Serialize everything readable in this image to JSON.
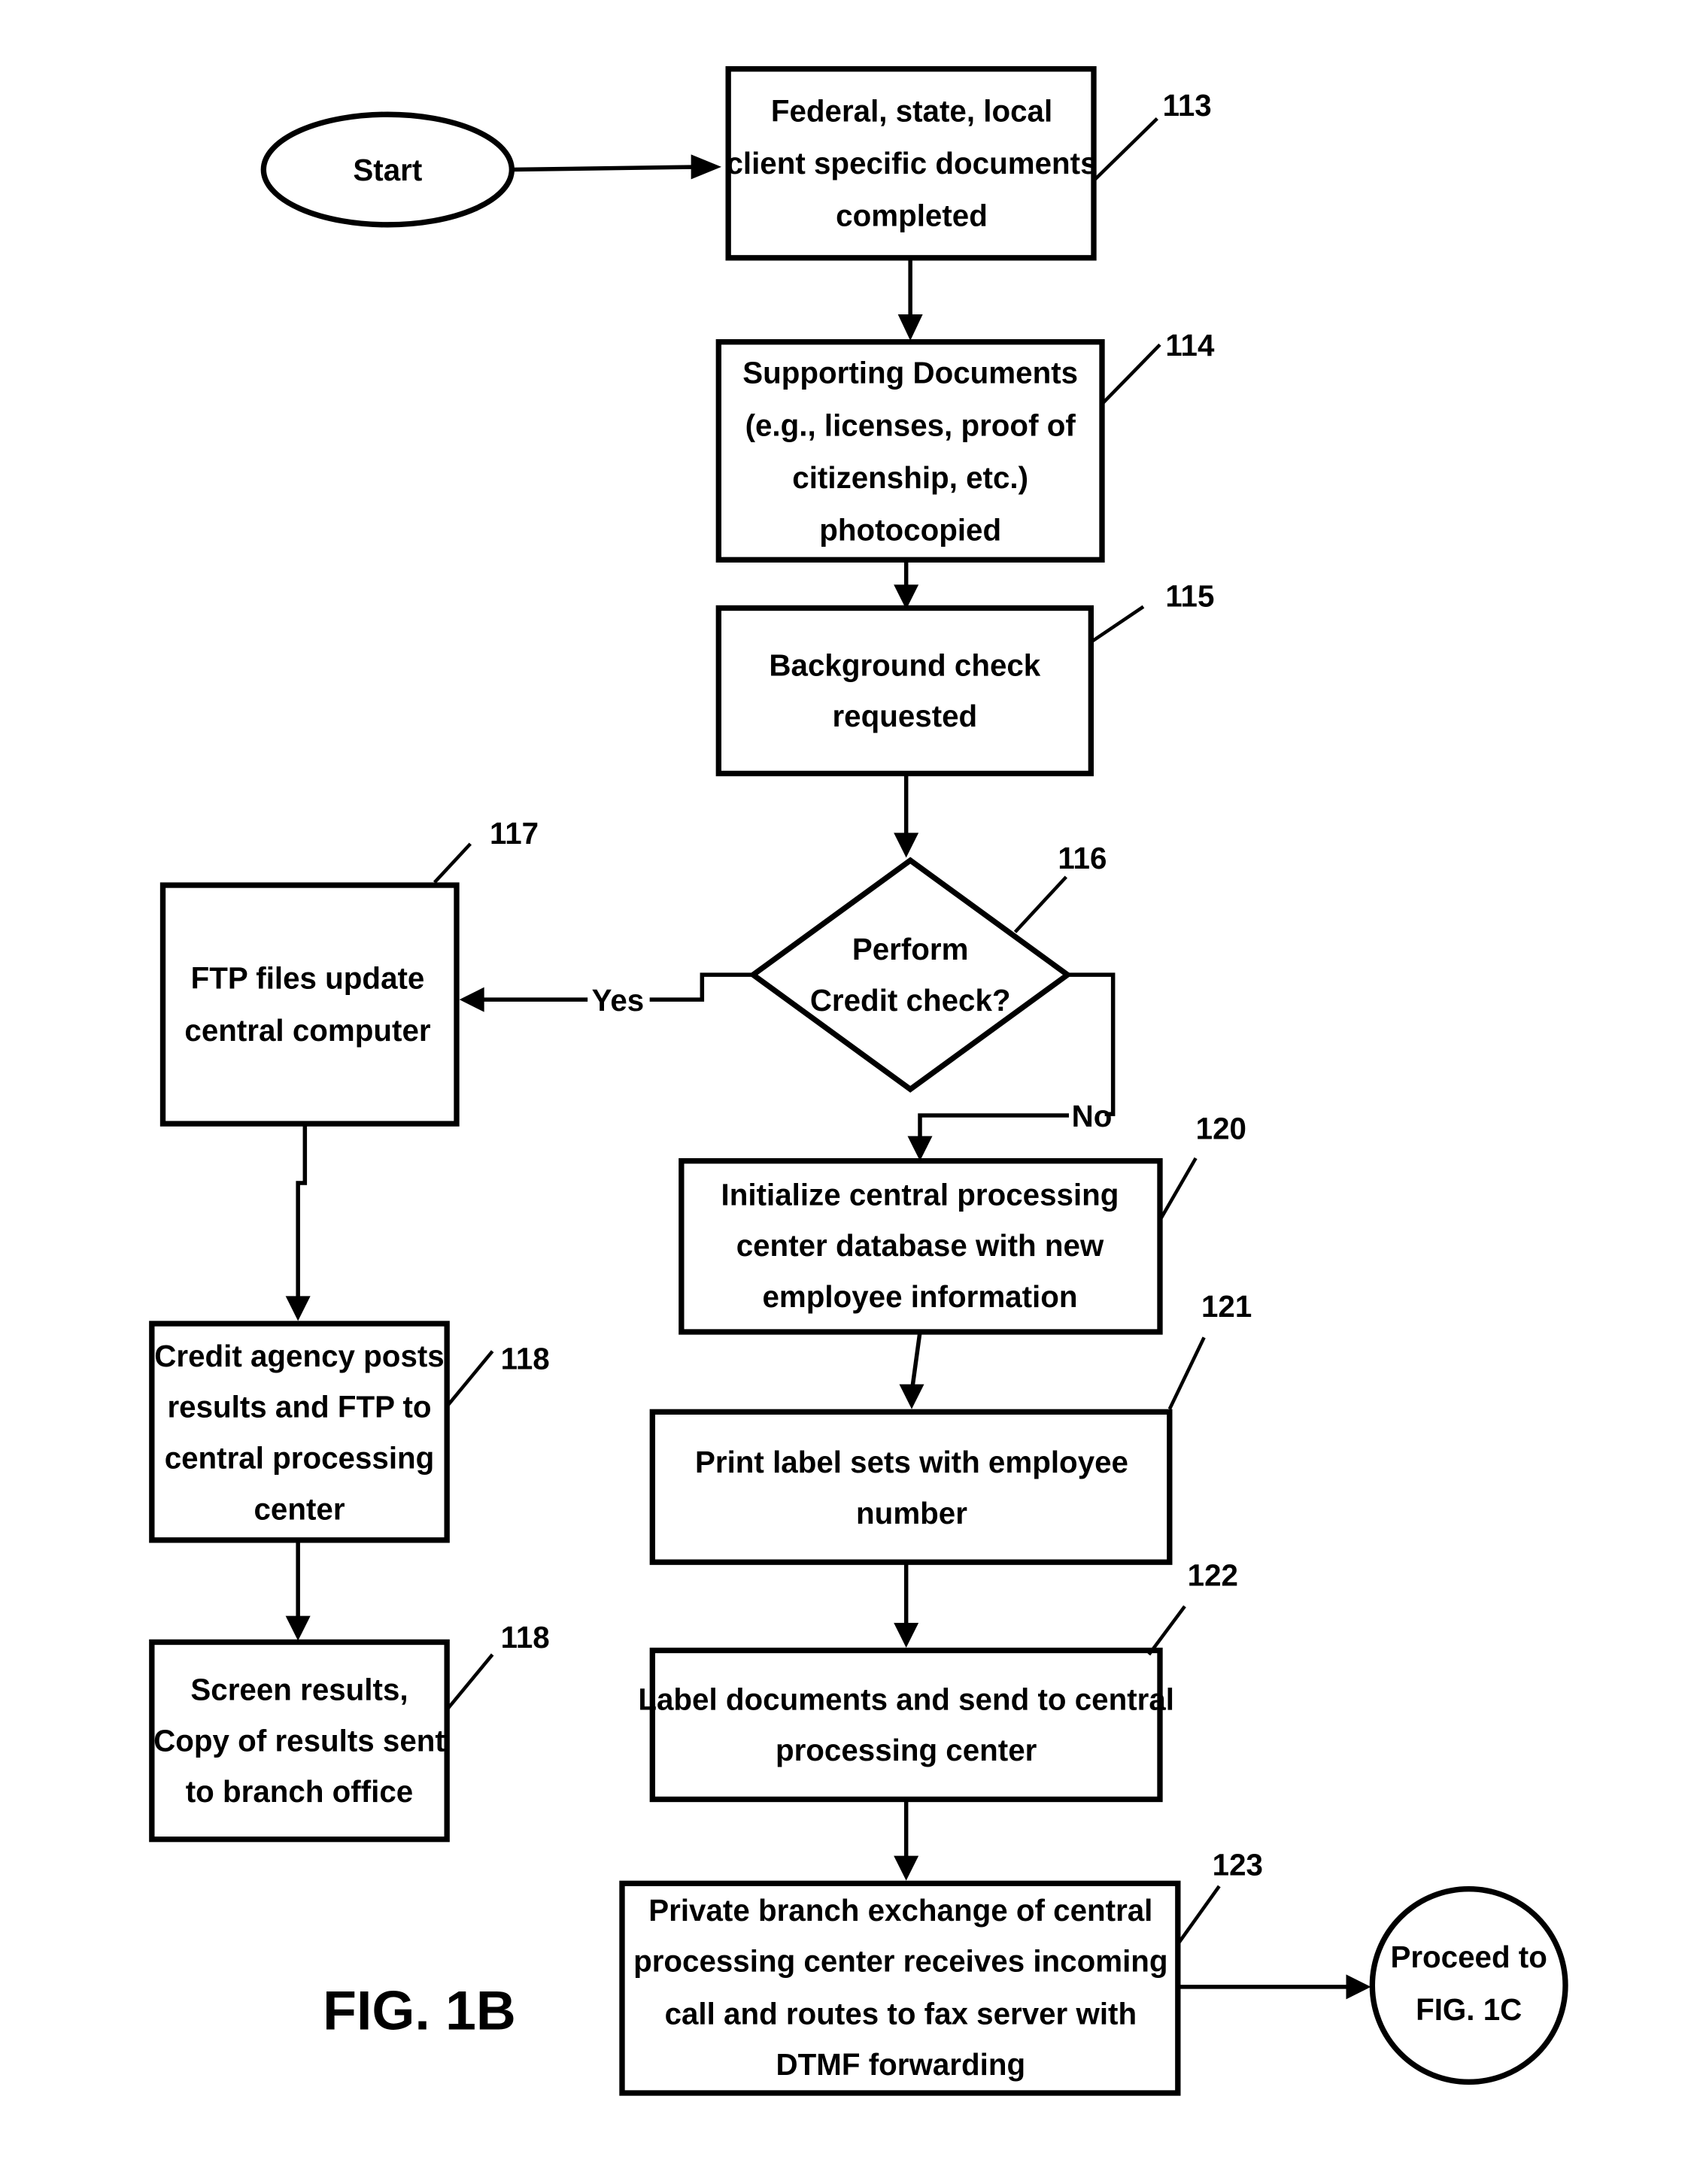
{
  "figure_label": "FIG. 1B",
  "nodes": {
    "start": {
      "text": "Start"
    },
    "n113": {
      "ref": "113",
      "lines": [
        "Federal, state, local",
        "client specific documents",
        "completed"
      ]
    },
    "n114": {
      "ref": "114",
      "lines": [
        "Supporting Documents",
        "(e.g., licenses, proof of",
        "citizenship, etc.)",
        "photocopied"
      ]
    },
    "n115": {
      "ref": "115",
      "lines": [
        "Background check",
        "requested"
      ]
    },
    "n116": {
      "ref": "116",
      "lines": [
        "Perform",
        "Credit check?"
      ]
    },
    "n117": {
      "ref": "117",
      "lines": [
        "FTP files update",
        "central computer"
      ]
    },
    "n118a": {
      "ref": "118",
      "lines": [
        "Credit agency posts",
        "results and FTP to",
        "central processing",
        "center"
      ]
    },
    "n118b": {
      "ref": "118",
      "lines": [
        "Screen results,",
        "Copy of results sent",
        "to branch office"
      ]
    },
    "n120": {
      "ref": "120",
      "lines": [
        "Initialize central processing",
        "center database with new",
        "employee information"
      ]
    },
    "n121": {
      "ref": "121",
      "lines": [
        "Print label sets with employee",
        "number"
      ]
    },
    "n122": {
      "ref": "122",
      "lines": [
        "Label documents and send to central",
        "processing center"
      ]
    },
    "n123": {
      "ref": "123",
      "lines": [
        "Private branch exchange of central",
        "processing center receives incoming",
        "call and routes to fax server with",
        "DTMF forwarding"
      ]
    },
    "end": {
      "lines": [
        "Proceed to",
        "FIG. 1C"
      ]
    }
  },
  "edges": {
    "yes_label": "Yes",
    "no_label": "No"
  }
}
